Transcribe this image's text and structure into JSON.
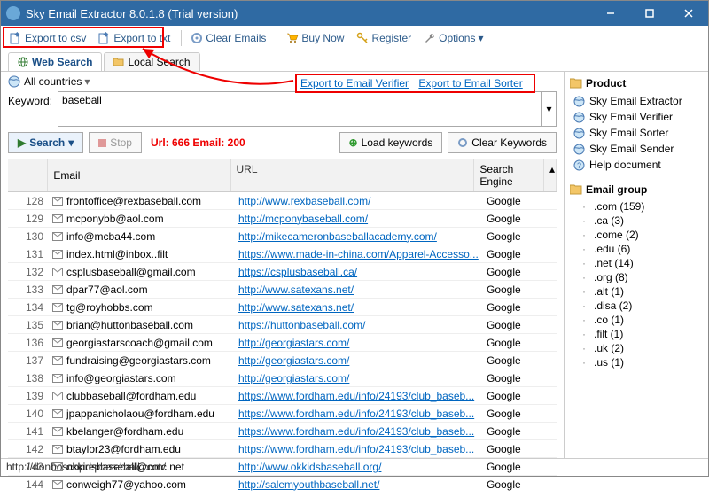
{
  "window": {
    "title": "Sky Email Extractor 8.0.1.8 (Trial version)"
  },
  "toolbar": {
    "export_csv": "Export to csv",
    "export_txt": "Export to txt",
    "clear_emails": "Clear Emails",
    "buy_now": "Buy Now",
    "register": "Register",
    "options": "Options"
  },
  "tabs": {
    "web": "Web Search",
    "local": "Local Search"
  },
  "search": {
    "countries": "All countries",
    "export_verifier": "Export to Email Verifier",
    "export_sorter": "Export to Email Sorter",
    "keyword_label": "Keyword:",
    "keyword_value": "baseball",
    "search_btn": "Search",
    "stop_btn": "Stop",
    "stats": "Url: 666 Email: 200",
    "load_keywords": "Load keywords",
    "clear_keywords": "Clear Keywords"
  },
  "grid": {
    "headers": {
      "email": "Email",
      "url": "URL",
      "engine": "Search Engine"
    },
    "rows": [
      {
        "n": 128,
        "email": "frontoffice@rexbaseball.com",
        "url": "http://www.rexbaseball.com/",
        "engine": "Google"
      },
      {
        "n": 129,
        "email": "mcponybb@aol.com",
        "url": "http://mcponybaseball.com/",
        "engine": "Google"
      },
      {
        "n": 130,
        "email": "info@mcba44.com",
        "url": "http://mikecameronbaseballacademy.com/",
        "engine": "Google"
      },
      {
        "n": 131,
        "email": "index.html@inbox..filt",
        "url": "https://www.made-in-china.com/Apparel-Accesso...",
        "engine": "Google"
      },
      {
        "n": 132,
        "email": "csplusbaseball@gmail.com",
        "url": "https://csplusbaseball.ca/",
        "engine": "Google"
      },
      {
        "n": 133,
        "email": "dpar77@aol.com",
        "url": "http://www.satexans.net/",
        "engine": "Google"
      },
      {
        "n": 134,
        "email": "tg@royhobbs.com",
        "url": "http://www.satexans.net/",
        "engine": "Google"
      },
      {
        "n": 135,
        "email": "brian@huttonbaseball.com",
        "url": "https://huttonbaseball.com/",
        "engine": "Google"
      },
      {
        "n": 136,
        "email": "georgiastarscoach@gmail.com",
        "url": "http://georgiastars.com/",
        "engine": "Google"
      },
      {
        "n": 137,
        "email": "fundraising@georgiastars.com",
        "url": "http://georgiastars.com/",
        "engine": "Google"
      },
      {
        "n": 138,
        "email": "info@georgiastars.com",
        "url": "http://georgiastars.com/",
        "engine": "Google"
      },
      {
        "n": 139,
        "email": "clubbaseball@fordham.edu",
        "url": "https://www.fordham.edu/info/24193/club_baseb...",
        "engine": "Google"
      },
      {
        "n": 140,
        "email": "jpappanicholaou@fordham.edu",
        "url": "https://www.fordham.edu/info/24193/club_baseb...",
        "engine": "Google"
      },
      {
        "n": 141,
        "email": "kbelanger@fordham.edu",
        "url": "https://www.fordham.edu/info/24193/club_baseb...",
        "engine": "Google"
      },
      {
        "n": 142,
        "email": "btaylor23@fordham.edu",
        "url": "https://www.fordham.edu/info/24193/club_baseb...",
        "engine": "Google"
      },
      {
        "n": 143,
        "email": "okkidsbaseball@cotc.net",
        "url": "http://www.okkidsbaseball.org/",
        "engine": "Google"
      },
      {
        "n": 144,
        "email": "conweigh77@yahoo.com",
        "url": "http://salemyouthbaseball.net/",
        "engine": "Google"
      }
    ]
  },
  "product_panel": {
    "title": "Product",
    "items": [
      "Sky Email Extractor",
      "Sky Email Verifier",
      "Sky Email Sorter",
      "Sky Email Sender",
      "Help document"
    ]
  },
  "group_panel": {
    "title": "Email group",
    "items": [
      ".com (159)",
      ".ca (3)",
      ".come (2)",
      ".edu (6)",
      ".net (14)",
      ".org (8)",
      ".alt (1)",
      ".disa (2)",
      ".co (1)",
      ".filt (1)",
      ".uk (2)",
      ".us (1)"
    ]
  },
  "statusbar": "http://donboscoprepbaseball.com/"
}
